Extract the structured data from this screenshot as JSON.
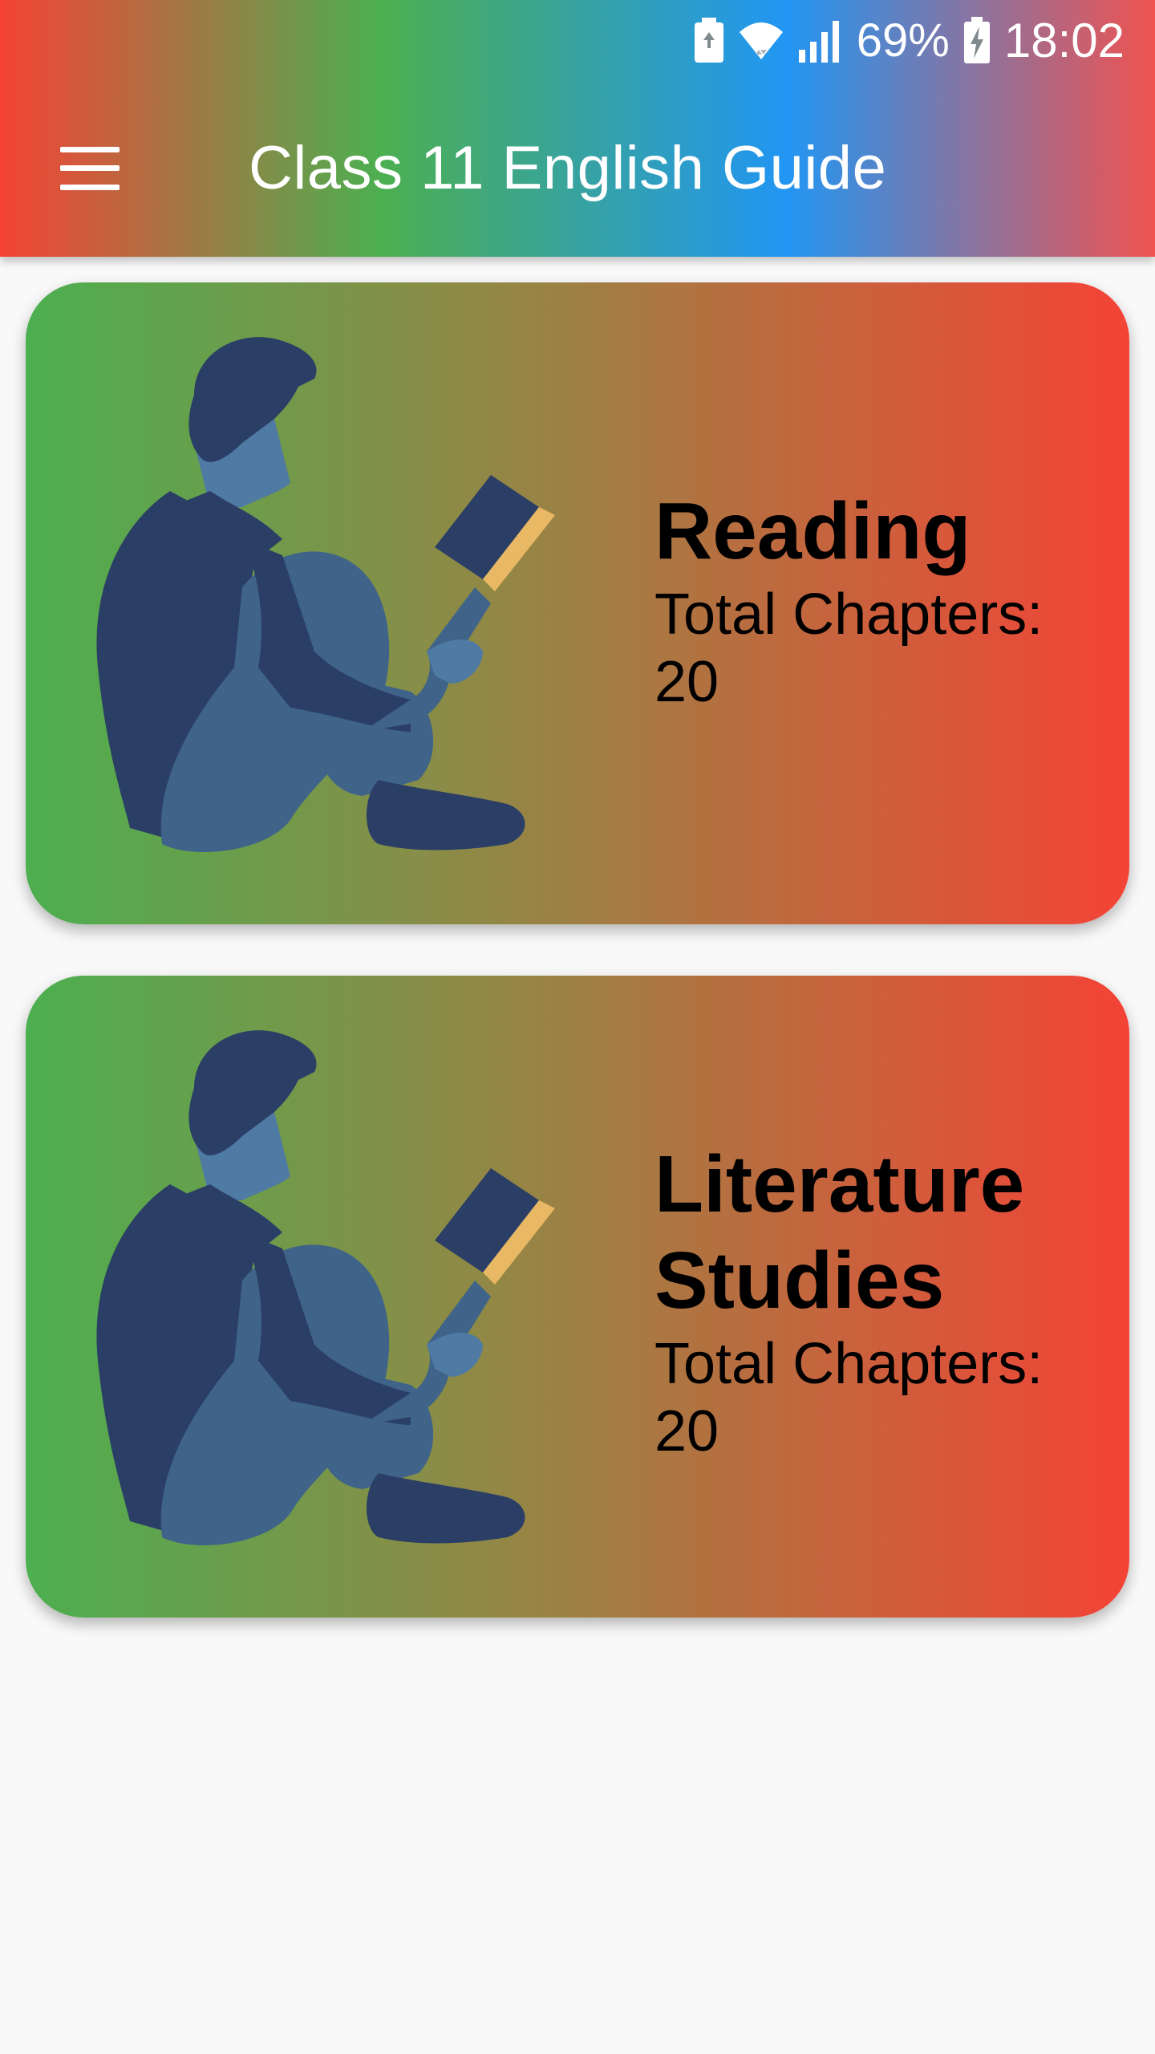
{
  "status_bar": {
    "battery_percent": "69%",
    "time": "18:02",
    "icons": [
      "battery-saver-icon",
      "wifi-icon",
      "signal-icon",
      "battery-charging-icon"
    ]
  },
  "app_bar": {
    "title": "Class 11 English Guide",
    "menu_icon": "hamburger-menu-icon"
  },
  "colors": {
    "gradient_red": "#f44336",
    "gradient_green": "#4caf50",
    "gradient_blue": "#2196f3",
    "figure_dark": "#2b3f66",
    "figure_light": "#3f6389",
    "book_page": "#e8b865"
  },
  "cards": [
    {
      "title": "Reading",
      "subtitle": "Total Chapters: 20",
      "illustration": "reading-person-illustration"
    },
    {
      "title": "Literature Studies",
      "subtitle": "Total Chapters: 20",
      "illustration": "reading-person-illustration"
    }
  ]
}
